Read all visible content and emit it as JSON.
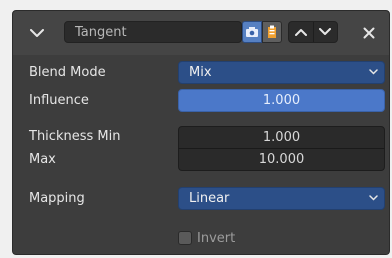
{
  "header": {
    "name": "Tangent",
    "collapse_icon": "chevron-down-icon",
    "render_icon": "camera-icon",
    "copy_icon": "clipboard-icon",
    "move_up_icon": "chevron-up-icon",
    "move_down_icon": "chevron-down-icon",
    "close_icon": "close-icon"
  },
  "fields": {
    "blend_mode": {
      "label": "Blend Mode",
      "value": "Mix"
    },
    "influence": {
      "label": "Influence",
      "value": "1.000"
    },
    "thickness_min": {
      "label": "Thickness Min",
      "value": "1.000"
    },
    "thickness_max": {
      "label": "Max",
      "value": "10.000"
    },
    "mapping": {
      "label": "Mapping",
      "value": "Linear"
    },
    "invert": {
      "label": "Invert",
      "checked": false
    }
  },
  "colors": {
    "panel_bg": "#3d3d3d",
    "accent_blue": "#4b78c9",
    "dropdown_blue": "#2c4f88",
    "field_dark": "#2a2a2a"
  }
}
